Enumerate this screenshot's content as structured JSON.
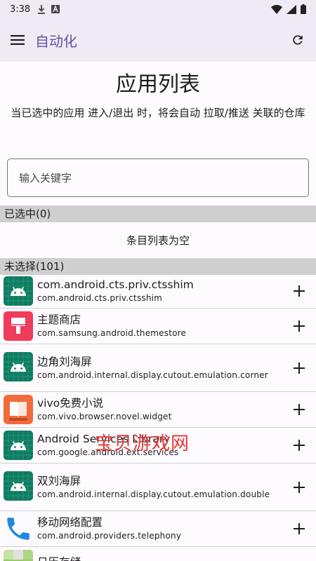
{
  "status_bar": {
    "time": "3:38"
  },
  "app_bar": {
    "title": "自动化",
    "menu_icon": "menu-icon",
    "refresh_icon": "refresh-icon"
  },
  "page": {
    "heading": "应用列表",
    "description": "当已选中的应用 进入/退出 时，将会自动 拉取/推送 关联的仓库"
  },
  "search": {
    "placeholder": "输入关键字"
  },
  "selected_section": {
    "label": "已选中(0)",
    "empty_text": "条目列表为空"
  },
  "unselected_section": {
    "label": "未选择(101)"
  },
  "apps": [
    {
      "name": "com.android.cts.priv.ctsshim",
      "package": "com.android.cts.priv.ctsshim",
      "icon": "android-icon"
    },
    {
      "name": "主题商店",
      "package": "com.samsung.android.themestore",
      "icon": "theme-store-icon"
    },
    {
      "name": "边角刘海屏",
      "package": "com.android.internal.display.cutout.emulation.corner",
      "icon": "android-icon"
    },
    {
      "name": "vivo免费小说",
      "package": "com.vivo.browser.novel.widget",
      "icon": "novel-icon"
    },
    {
      "name": "Android Services Library",
      "package": "com.google.android.ext.services",
      "icon": "android-icon"
    },
    {
      "name": "双刘海屏",
      "package": "com.android.internal.display.cutout.emulation.double",
      "icon": "android-icon"
    },
    {
      "name": "移动网络配置",
      "package": "com.android.providers.telephony",
      "icon": "phone-icon"
    },
    {
      "name": "日历存储",
      "package": "",
      "icon": "calendar-icon"
    }
  ],
  "watermark": "宝贝游戏网",
  "colors": {
    "accent": "#6750a4",
    "app_bar_bg": "#efeaf4",
    "section_bg": "#cfcfcf",
    "android_icon_bg": "#0e7c61",
    "watermark": "#e53935"
  }
}
